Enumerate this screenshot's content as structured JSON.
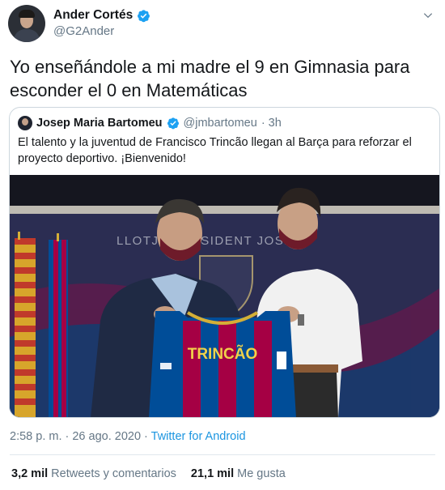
{
  "tweet": {
    "author_name": "Ander Cortés",
    "author_handle": "@G2Ander",
    "text_line1": "Yo enseñándole a mi madre el 9 en Gimnasia para",
    "text_line2": "esconder el 0 en Matemáticas",
    "timestamp": "2:58 p. m. · 26 ago. 2020",
    "separator": " · ",
    "source": "Twitter for Android",
    "retweets_count": "3,2 mil",
    "retweets_label": "Retweets y comentarios",
    "likes_count": "21,1 mil",
    "likes_label": "Me gusta"
  },
  "quoted": {
    "author_name": "Josep Maria Bartomeu",
    "author_handle": "@jmbartomeu",
    "time_ago": "· 3h",
    "text": "El talento y la juventud de Francisco Trincão llegan al Barça para reforzar el proyecto deportivo. ¡Bienvenido!",
    "photo": {
      "backdrop_text": "LLOTJA  PRESIDENT JOSEP",
      "jersey_text": "TRINCÃO"
    }
  },
  "icons": {
    "verified": "verified-badge-icon",
    "menu": "chevron-down-icon"
  },
  "colors": {
    "verified": "#1da1f2",
    "link": "#1b95e0",
    "secondary_text": "#657786",
    "border": "#ccd6dd"
  }
}
